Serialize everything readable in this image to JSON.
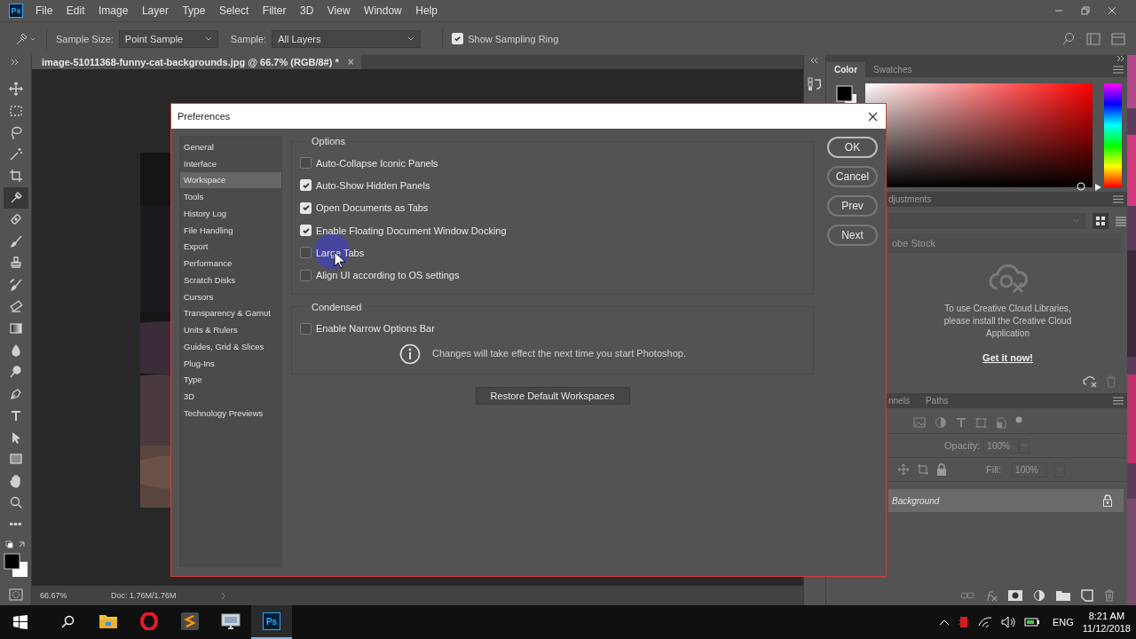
{
  "app": {
    "logo": "Ps",
    "menu": [
      "File",
      "Edit",
      "Image",
      "Layer",
      "Type",
      "Select",
      "Filter",
      "3D",
      "View",
      "Window",
      "Help"
    ]
  },
  "options_bar": {
    "sample_size_label": "Sample Size:",
    "sample_size": "Point Sample",
    "sample_label": "Sample:",
    "sample": "All Layers",
    "sampling_ring": {
      "label": "Show Sampling Ring",
      "checked": true
    }
  },
  "document_tab": {
    "title": "image-51011368-funny-cat-backgrounds.jpg @ 66.7% (RGB/8#) *",
    "close": "×"
  },
  "toolbar": {
    "tools": [
      {
        "selected": false
      },
      {
        "selected": false
      },
      {
        "selected": false
      },
      {
        "selected": false
      },
      {
        "selected": false
      },
      {
        "selected": true
      },
      {
        "selected": false
      },
      {
        "selected": false
      },
      {
        "selected": false
      },
      {
        "selected": false
      },
      {
        "selected": false
      },
      {
        "selected": false
      },
      {
        "selected": false
      },
      {
        "selected": false
      },
      {
        "selected": false
      },
      {
        "selected": false
      },
      {
        "selected": false
      },
      {
        "selected": false
      },
      {
        "selected": false
      },
      {
        "selected": false
      },
      {
        "selected": false
      }
    ]
  },
  "status_bar": {
    "zoom": "66.67%",
    "doc": "Doc: 1.76M/1.76M"
  },
  "color_panel": {
    "tabs": [
      {
        "label": "Color",
        "selected": true
      },
      {
        "label": "Swatches",
        "selected": false
      }
    ],
    "hue": {
      "level": 0
    }
  },
  "libraries_panel": {
    "tabs": [
      {
        "label": "djustments",
        "selected": false
      }
    ],
    "source": "obe Stock",
    "message": "To use Creative Cloud Libraries, please install the Creative Cloud Application",
    "link": "Get it now!"
  },
  "layers_panel": {
    "tabs": [
      {
        "label": "nnels",
        "selected": false
      },
      {
        "label": "Paths",
        "selected": false
      }
    ],
    "opacity_label": "Opacity:",
    "opacity": "100%",
    "fill_label": "Fill:",
    "fill": "100%",
    "layers": [
      {
        "name": "Background",
        "selected": true,
        "locked": true
      }
    ]
  },
  "dialog": {
    "title": "Preferences",
    "categories": [
      {
        "label": "General",
        "selected": false
      },
      {
        "label": "Interface",
        "selected": false
      },
      {
        "label": "Workspace",
        "selected": true
      },
      {
        "label": "Tools",
        "selected": false
      },
      {
        "label": "History Log",
        "selected": false
      },
      {
        "label": "File Handling",
        "selected": false
      },
      {
        "label": "Export",
        "selected": false
      },
      {
        "label": "Performance",
        "selected": false
      },
      {
        "label": "Scratch Disks",
        "selected": false
      },
      {
        "label": "Cursors",
        "selected": false
      },
      {
        "label": "Transparency & Gamut",
        "selected": false
      },
      {
        "label": "Units & Rulers",
        "selected": false
      },
      {
        "label": "Guides, Grid & Slices",
        "selected": false
      },
      {
        "label": "Plug-Ins",
        "selected": false
      },
      {
        "label": "Type",
        "selected": false
      },
      {
        "label": "3D",
        "selected": false
      },
      {
        "label": "Technology Previews",
        "selected": false
      }
    ],
    "options": {
      "title": "Options",
      "items": [
        {
          "label": "Auto-Collapse Iconic Panels",
          "checked": false
        },
        {
          "label": "Auto-Show Hidden Panels",
          "checked": true
        },
        {
          "label": "Open Documents as Tabs",
          "checked": true
        },
        {
          "label": "Enable Floating Document Window Docking",
          "checked": true
        },
        {
          "label": "Large Tabs",
          "checked": false
        },
        {
          "label": "Align UI according to OS settings",
          "checked": false
        }
      ]
    },
    "condensed": {
      "title": "Condensed",
      "items": [
        {
          "label": "Enable Narrow Options Bar",
          "checked": false
        }
      ],
      "note": "Changes will take effect the next time you start Photoshop."
    },
    "restore_button": "Restore Default Workspaces",
    "buttons": [
      {
        "label": "OK",
        "default": true
      },
      {
        "label": "Cancel",
        "default": false
      },
      {
        "label": "Prev",
        "default": false
      },
      {
        "label": "Next",
        "default": false
      }
    ]
  },
  "taskbar": {
    "apps": [
      {
        "kind": "folder",
        "selected": false
      },
      {
        "kind": "ring",
        "selected": false
      },
      {
        "kind": "tile",
        "selected": false
      },
      {
        "kind": "monitor",
        "selected": false
      },
      {
        "kind": "ps",
        "label": "Ps",
        "selected": true
      }
    ],
    "language": "ENG",
    "time": "8:21 AM",
    "date": "11/12/2018"
  }
}
